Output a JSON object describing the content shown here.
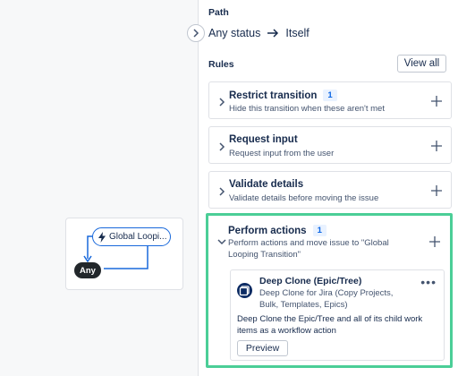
{
  "canvas": {
    "nodes": [
      {
        "label": "Global Loopi..."
      },
      {
        "label": "Any"
      }
    ]
  },
  "panel": {
    "path_label": "Path",
    "path_from": "Any status",
    "path_to": "Itself",
    "rules_label": "Rules",
    "view_all_label": "View all",
    "rules": [
      {
        "title": "Restrict transition",
        "badge": "1",
        "description": "Hide this transition when these aren't met"
      },
      {
        "title": "Request input",
        "badge": "",
        "description": "Request input from the user"
      },
      {
        "title": "Validate details",
        "badge": "",
        "description": "Validate details before moving the issue"
      },
      {
        "title": "Perform actions",
        "badge": "1",
        "description_line1": "Perform actions and move issue to \"Global",
        "description_line2": "Looping Transition\""
      }
    ],
    "action": {
      "title": "Deep Clone (Epic/Tree)",
      "subtitle_line1": "Deep Clone for Jira (Copy Projects,",
      "subtitle_line2": "Bulk, Templates, Epics)",
      "description_line1": "Deep Clone the Epic/Tree and all of its child work",
      "description_line2": "items as a workflow action",
      "preview_label": "Preview"
    }
  },
  "colors": {
    "accent": "#1868db",
    "selected_border": "#4bce97",
    "badge_bg": "#e9f2ff",
    "badge_text": "#0c66e4"
  },
  "icons": [
    "chevron-right-icon",
    "arrow-right-icon",
    "plus-icon",
    "chevron-down-icon",
    "more-icon",
    "lightning-icon",
    "deep-clone-app-icon"
  ]
}
